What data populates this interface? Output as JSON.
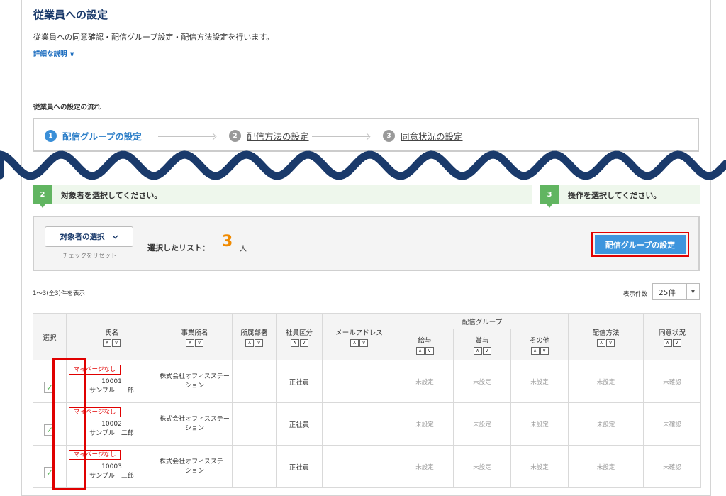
{
  "page": {
    "title": "従業員への設定",
    "description": "従業員への同意確認・配信グループ設定・配信方法設定を行います。",
    "detail_link": "詳細な説明 ∨"
  },
  "flow": {
    "title": "従業員への設定の流れ",
    "steps": [
      {
        "num": "1",
        "label": "配信グループの設定"
      },
      {
        "num": "2",
        "label": "配信方法の設定"
      },
      {
        "num": "3",
        "label": "同意状況の設定"
      }
    ]
  },
  "instructions": [
    {
      "num": "2",
      "text": "対象者を選択してください。"
    },
    {
      "num": "3",
      "text": "操作を選択してください。"
    }
  ],
  "selection": {
    "button": "対象者の選択",
    "reset": "チェックをリセット",
    "label": "選択したリスト：",
    "count": "3",
    "unit": "人",
    "action_button": "配信グループの設定"
  },
  "list": {
    "range": "1～3(全3)件を表示",
    "page_size_label": "表示件数",
    "page_size": "25件"
  },
  "table": {
    "headers": {
      "select": "選択",
      "name": "氏名",
      "office": "事業所名",
      "dept": "所属部署",
      "type": "社員区分",
      "email": "メールアドレス",
      "group": "配信グループ",
      "salary": "給与",
      "bonus": "賞与",
      "other": "その他",
      "method": "配信方法",
      "consent": "同意状況"
    },
    "rows": [
      {
        "badge": "マイページなし",
        "id": "10001",
        "name": "サンプル　一郎",
        "office": "株式会社オフィスステーション",
        "dept": "",
        "type": "正社員",
        "email": "",
        "salary": "未設定",
        "bonus": "未設定",
        "other": "未設定",
        "method": "未設定",
        "consent": "未確認"
      },
      {
        "badge": "マイページなし",
        "id": "10002",
        "name": "サンプル　二郎",
        "office": "株式会社オフィスステーション",
        "dept": "",
        "type": "正社員",
        "email": "",
        "salary": "未設定",
        "bonus": "未設定",
        "other": "未設定",
        "method": "未設定",
        "consent": "未確認"
      },
      {
        "badge": "マイページなし",
        "id": "10003",
        "name": "サンプル　三郎",
        "office": "株式会社オフィスステーション",
        "dept": "",
        "type": "正社員",
        "email": "",
        "salary": "未設定",
        "bonus": "未設定",
        "other": "未設定",
        "method": "未設定",
        "consent": "未確認"
      }
    ]
  },
  "colors": {
    "accent": "#3e95dd",
    "highlight": "#e00000",
    "green": "#61b561",
    "title": "#1a3a6b"
  }
}
